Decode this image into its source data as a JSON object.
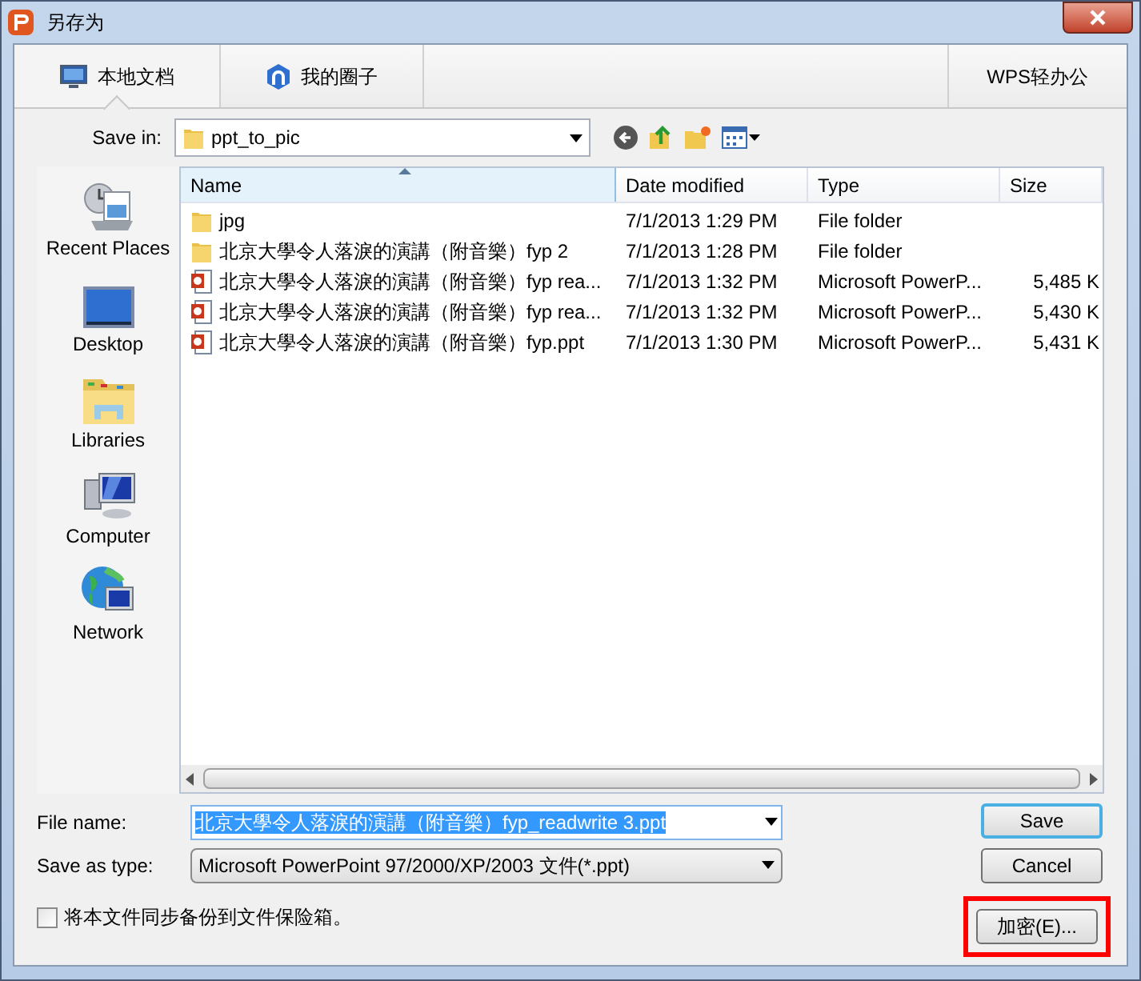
{
  "window": {
    "title": "另存为"
  },
  "tabs": [
    {
      "label": "本地文档",
      "kind": "local",
      "selected": true
    },
    {
      "label": "我的圈子",
      "kind": "circle",
      "selected": false
    }
  ],
  "right_tab": {
    "label": "WPS轻办公"
  },
  "save_in": {
    "label": "Save in:",
    "value": "ppt_to_pic"
  },
  "sidebar": {
    "items": [
      {
        "label": "Recent Places",
        "kind": "recent"
      },
      {
        "label": "Desktop",
        "kind": "desktop"
      },
      {
        "label": "Libraries",
        "kind": "libraries"
      },
      {
        "label": "Computer",
        "kind": "computer"
      },
      {
        "label": "Network",
        "kind": "network"
      }
    ]
  },
  "table": {
    "columns": [
      "Name",
      "Date modified",
      "Type",
      "Size"
    ],
    "rows": [
      {
        "kind": "folder",
        "name": "jpg",
        "date": "7/1/2013 1:29 PM",
        "type": "File folder"
      },
      {
        "kind": "folder",
        "name": "北京大學令人落淚的演講（附音樂）fyp 2",
        "date": "7/1/2013 1:28 PM",
        "type": "File folder"
      },
      {
        "kind": "ppt",
        "name": "北京大學令人落淚的演講（附音樂）fyp  rea...",
        "date": "7/1/2013 1:32 PM",
        "type": "Microsoft PowerP...",
        "size": "5,485 K"
      },
      {
        "kind": "ppt",
        "name": "北京大學令人落淚的演講（附音樂）fyp  rea...",
        "date": "7/1/2013 1:32 PM",
        "type": "Microsoft PowerP...",
        "size": "5,430 K"
      },
      {
        "kind": "ppt",
        "name": "北京大學令人落淚的演講（附音樂）fyp.ppt",
        "date": "7/1/2013 1:30 PM",
        "type": "Microsoft PowerP...",
        "size": "5,431 K"
      }
    ]
  },
  "file_name": {
    "label": "File name:",
    "value": "北京大學令人落淚的演講（附音樂）fyp_readwrite 3.ppt",
    "selected": true
  },
  "save_as_type": {
    "label": "Save as type:",
    "value": "Microsoft PowerPoint 97/2000/XP/2003 文件(*.ppt)"
  },
  "backup": {
    "label": "将本文件同步备份到文件保险箱。",
    "checked": false
  },
  "buttons": [
    {
      "label": "Save",
      "default": true,
      "highlighted": false
    },
    {
      "label": "Cancel",
      "default": false,
      "highlighted": false
    },
    {
      "label": "加密(E)...",
      "default": false,
      "highlighted": true
    }
  ]
}
